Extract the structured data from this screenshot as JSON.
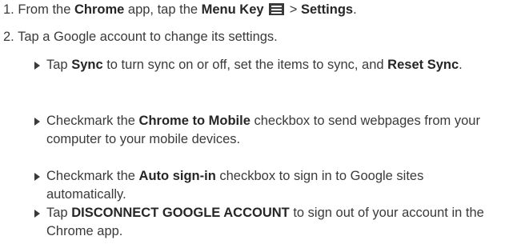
{
  "steps": [
    {
      "number": "1.",
      "text_a": "From the ",
      "bold_a": "Chrome",
      "text_b": " app, tap the ",
      "bold_b": "Menu Key",
      "text_c": " > ",
      "bold_c": "Settings",
      "text_d": ".",
      "icon": "menu-key-icon"
    },
    {
      "number": "2.",
      "text": "Tap a Google account to change its settings."
    }
  ],
  "bullets": [
    {
      "text_a": "Tap ",
      "bold_a": "Sync",
      "text_b": " to turn sync on or off, set the items to sync, and ",
      "bold_b": "Reset Sync",
      "text_c": "."
    },
    {
      "text_a": "Checkmark the ",
      "bold_a": "Chrome to Mobile",
      "text_b": " checkbox to send webpages from your computer to your mobile devices."
    },
    {
      "text_a": "Checkmark the ",
      "bold_a": "Auto sign-in",
      "text_b": " checkbox to sign in to Google sites automatically."
    },
    {
      "text_a": "Tap ",
      "bold_a": "DISCONNECT GOOGLE ACCOUNT",
      "text_b": " to sign out of your account in the Chrome app."
    }
  ]
}
